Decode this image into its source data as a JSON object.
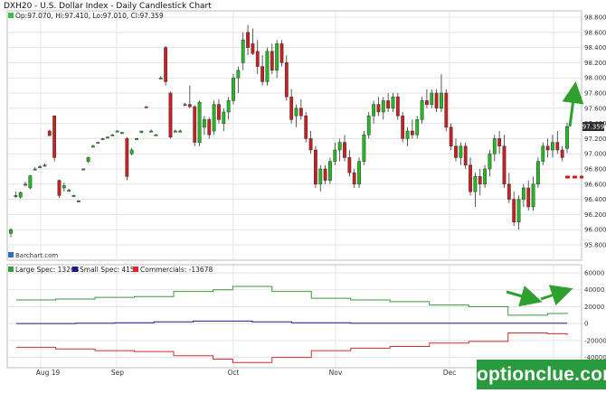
{
  "header": {
    "title": "DXH20 - U.S. Dollar Index - Daily Candlestick Chart",
    "ohlc_legend": "Op:97.070, Hi:97.410, Lo:97.010, Cl:97.359"
  },
  "price_axis": {
    "ticks": [
      "98.800",
      "98.600",
      "98.400",
      "98.200",
      "98.000",
      "97.800",
      "97.600",
      "97.400",
      "97.200",
      "97.000",
      "96.800",
      "96.600",
      "96.400",
      "96.200",
      "96.000",
      "95.800"
    ],
    "last_price": "97.359"
  },
  "cot_axis": {
    "ticks": [
      "60000",
      "40000",
      "20000",
      "0",
      "-20000",
      "-40000"
    ]
  },
  "cot_legend": {
    "large": "Large Spec: 13263",
    "small": "Small Spec: 415",
    "commercials": "Commercials: -13678"
  },
  "x_axis": {
    "labels": [
      "Aug 19",
      "Sep",
      "Oct",
      "Nov",
      "Dec"
    ]
  },
  "branding": {
    "barchart": "Barchart.com",
    "watermark": "optionclue.com"
  },
  "colors": {
    "up": "#22bb22",
    "down": "#cc1f1f",
    "large_spec": "#3a9a3a",
    "small_spec": "#1a1a8c",
    "commercials": "#d42a2a",
    "annotation": "#2da02d",
    "dash": "#cc1f1f"
  },
  "chart_data": [
    {
      "type": "candlestick",
      "title": "DXH20 - U.S. Dollar Index - Daily Candlestick Chart",
      "ylim": [
        95.8,
        98.8
      ],
      "ohlc": [
        [
          95.95,
          96.02,
          95.9,
          96.0
        ],
        [
          96.45,
          96.5,
          96.42,
          96.45
        ],
        [
          96.43,
          96.5,
          96.41,
          96.49
        ],
        [
          96.6,
          96.63,
          96.57,
          96.6
        ],
        [
          96.55,
          96.72,
          96.53,
          96.71
        ],
        [
          96.8,
          96.82,
          96.78,
          96.8
        ],
        [
          96.83,
          96.85,
          96.81,
          96.83
        ],
        [
          96.85,
          96.87,
          96.83,
          96.85
        ],
        [
          97.3,
          97.32,
          97.23,
          97.24
        ],
        [
          97.5,
          97.5,
          96.9,
          96.95
        ],
        [
          96.65,
          96.66,
          96.42,
          96.45
        ],
        [
          96.55,
          96.62,
          96.5,
          96.58
        ],
        [
          96.52,
          96.54,
          96.5,
          96.52
        ],
        [
          96.45,
          96.46,
          96.43,
          96.45
        ],
        [
          96.38,
          96.39,
          96.36,
          96.38
        ],
        [
          96.8,
          96.81,
          96.79,
          96.8
        ],
        [
          96.9,
          96.96,
          96.88,
          96.95
        ],
        [
          97.1,
          97.12,
          97.09,
          97.1
        ],
        [
          97.15,
          97.16,
          97.14,
          97.15
        ],
        [
          97.2,
          97.21,
          97.19,
          97.2
        ],
        [
          97.22,
          97.23,
          97.21,
          97.22
        ],
        [
          97.25,
          97.26,
          97.24,
          97.25
        ],
        [
          97.3,
          97.31,
          97.29,
          97.3
        ],
        [
          97.28,
          97.29,
          97.27,
          97.28
        ],
        [
          97.2,
          97.22,
          96.65,
          96.7
        ],
        [
          97.0,
          97.08,
          96.98,
          97.05
        ],
        [
          97.2,
          97.21,
          97.19,
          97.2
        ],
        [
          97.28,
          97.3,
          97.27,
          97.3
        ],
        [
          97.62,
          97.63,
          97.6,
          97.62
        ],
        [
          97.3,
          97.32,
          97.28,
          97.3
        ],
        [
          97.25,
          97.26,
          97.24,
          97.25
        ],
        [
          98.0,
          98.02,
          97.98,
          98.0
        ],
        [
          98.4,
          98.42,
          97.9,
          97.95
        ],
        [
          97.8,
          97.82,
          97.2,
          97.22
        ],
        [
          97.3,
          97.32,
          97.28,
          97.3
        ],
        [
          97.3,
          97.32,
          97.28,
          97.3
        ],
        [
          97.65,
          97.67,
          97.63,
          97.65
        ],
        [
          97.65,
          97.9,
          97.6,
          97.62
        ],
        [
          97.62,
          97.64,
          97.1,
          97.15
        ],
        [
          97.15,
          97.7,
          97.1,
          97.68
        ],
        [
          97.35,
          97.5,
          97.25,
          97.45
        ],
        [
          97.45,
          97.48,
          97.2,
          97.25
        ],
        [
          97.3,
          97.7,
          97.25,
          97.65
        ],
        [
          97.65,
          97.72,
          97.4,
          97.45
        ],
        [
          97.4,
          97.6,
          97.3,
          97.55
        ],
        [
          97.55,
          97.75,
          97.45,
          97.7
        ],
        [
          97.7,
          98.05,
          97.65,
          98.0
        ],
        [
          98.0,
          98.15,
          97.8,
          98.1
        ],
        [
          98.2,
          98.6,
          98.1,
          98.5
        ],
        [
          98.6,
          98.7,
          98.3,
          98.4
        ],
        [
          98.45,
          98.65,
          98.3,
          98.32
        ],
        [
          98.35,
          98.5,
          98.05,
          98.15
        ],
        [
          98.15,
          98.3,
          97.9,
          97.95
        ],
        [
          97.95,
          98.4,
          97.9,
          98.35
        ],
        [
          98.35,
          98.45,
          98.05,
          98.1
        ],
        [
          98.1,
          98.5,
          98.0,
          98.45
        ],
        [
          98.45,
          98.5,
          98.15,
          98.2
        ],
        [
          98.2,
          98.3,
          97.7,
          97.75
        ],
        [
          97.75,
          97.85,
          97.4,
          97.45
        ],
        [
          97.5,
          97.65,
          97.35,
          97.6
        ],
        [
          97.6,
          97.72,
          97.45,
          97.5
        ],
        [
          97.5,
          97.55,
          97.15,
          97.2
        ],
        [
          97.2,
          97.3,
          97.0,
          97.05
        ],
        [
          97.05,
          97.1,
          96.55,
          96.6
        ],
        [
          96.6,
          96.85,
          96.5,
          96.8
        ],
        [
          96.8,
          96.85,
          96.6,
          96.65
        ],
        [
          96.65,
          96.95,
          96.6,
          96.9
        ],
        [
          96.9,
          97.15,
          96.85,
          97.05
        ],
        [
          97.05,
          97.2,
          96.9,
          97.15
        ],
        [
          97.15,
          97.25,
          96.9,
          96.95
        ],
        [
          96.95,
          97.05,
          96.7,
          96.75
        ],
        [
          96.75,
          96.8,
          96.55,
          96.6
        ],
        [
          96.6,
          96.95,
          96.55,
          96.9
        ],
        [
          96.9,
          97.3,
          96.85,
          97.25
        ],
        [
          97.25,
          97.55,
          97.2,
          97.5
        ],
        [
          97.5,
          97.7,
          97.4,
          97.65
        ],
        [
          97.65,
          97.75,
          97.5,
          97.55
        ],
        [
          97.55,
          97.75,
          97.45,
          97.7
        ],
        [
          97.7,
          97.8,
          97.55,
          97.6
        ],
        [
          97.6,
          97.8,
          97.55,
          97.75
        ],
        [
          97.75,
          97.8,
          97.45,
          97.5
        ],
        [
          97.5,
          97.55,
          97.15,
          97.2
        ],
        [
          97.2,
          97.35,
          97.1,
          97.3
        ],
        [
          97.3,
          97.45,
          97.2,
          97.25
        ],
        [
          97.25,
          97.5,
          97.2,
          97.45
        ],
        [
          97.45,
          97.75,
          97.4,
          97.7
        ],
        [
          97.7,
          97.85,
          97.6,
          97.65
        ],
        [
          97.65,
          97.85,
          97.6,
          97.8
        ],
        [
          97.8,
          97.85,
          97.55,
          97.6
        ],
        [
          97.6,
          98.05,
          97.55,
          97.8
        ],
        [
          97.8,
          97.85,
          97.3,
          97.35
        ],
        [
          97.35,
          97.4,
          97.05,
          97.1
        ],
        [
          97.1,
          97.2,
          96.9,
          96.95
        ],
        [
          96.95,
          97.15,
          96.85,
          97.1
        ],
        [
          97.1,
          97.15,
          96.8,
          96.85
        ],
        [
          96.85,
          96.95,
          96.45,
          96.5
        ],
        [
          96.5,
          96.75,
          96.3,
          96.7
        ],
        [
          96.7,
          96.8,
          96.45,
          96.6
        ],
        [
          96.6,
          96.85,
          96.55,
          96.8
        ],
        [
          96.8,
          97.05,
          96.7,
          97.0
        ],
        [
          97.0,
          97.25,
          96.9,
          97.2
        ],
        [
          97.2,
          97.3,
          97.0,
          97.1
        ],
        [
          97.1,
          97.25,
          96.55,
          96.6
        ],
        [
          96.6,
          96.75,
          96.35,
          96.4
        ],
        [
          96.4,
          96.5,
          96.05,
          96.1
        ],
        [
          96.1,
          96.45,
          96.0,
          96.4
        ],
        [
          96.4,
          96.6,
          96.3,
          96.55
        ],
        [
          96.55,
          96.65,
          96.25,
          96.3
        ],
        [
          96.3,
          96.7,
          96.25,
          96.6
        ],
        [
          96.6,
          96.95,
          96.55,
          96.9
        ],
        [
          96.9,
          97.15,
          96.85,
          97.1
        ],
        [
          97.1,
          97.2,
          96.95,
          97.05
        ],
        [
          97.05,
          97.25,
          96.95,
          97.15
        ],
        [
          97.15,
          97.3,
          97.0,
          97.05
        ],
        [
          97.05,
          97.1,
          96.9,
          96.95
        ],
        [
          97.07,
          97.41,
          97.01,
          97.359
        ]
      ]
    },
    {
      "type": "line",
      "title": "",
      "ylim": [
        -50000,
        60000
      ],
      "series": [
        {
          "name": "Large Spec",
          "values": [
            28000,
            28000,
            29000,
            29000,
            31000,
            31000,
            32000,
            32000,
            38000,
            38000,
            40000,
            44000,
            44000,
            38000,
            38000,
            30000,
            30000,
            28000,
            28000,
            26000,
            26000,
            22000,
            22000,
            20000,
            20000,
            10000,
            10000,
            12000,
            13263
          ]
        },
        {
          "name": "Small Spec",
          "values": [
            0,
            0,
            0,
            500,
            500,
            1000,
            1000,
            2000,
            2000,
            3000,
            3000,
            3000,
            2000,
            2000,
            1000,
            1000,
            1000,
            500,
            500,
            500,
            500,
            400,
            400,
            400,
            400,
            415,
            415,
            415,
            415
          ]
        },
        {
          "name": "Commercials",
          "values": [
            -28000,
            -28000,
            -30000,
            -30000,
            -32000,
            -32000,
            -33000,
            -33000,
            -38000,
            -38000,
            -42000,
            -46000,
            -46000,
            -40000,
            -40000,
            -32000,
            -32000,
            -29000,
            -29000,
            -27000,
            -27000,
            -23000,
            -23000,
            -21000,
            -21000,
            -11000,
            -11000,
            -12000,
            -13678
          ]
        }
      ]
    }
  ]
}
